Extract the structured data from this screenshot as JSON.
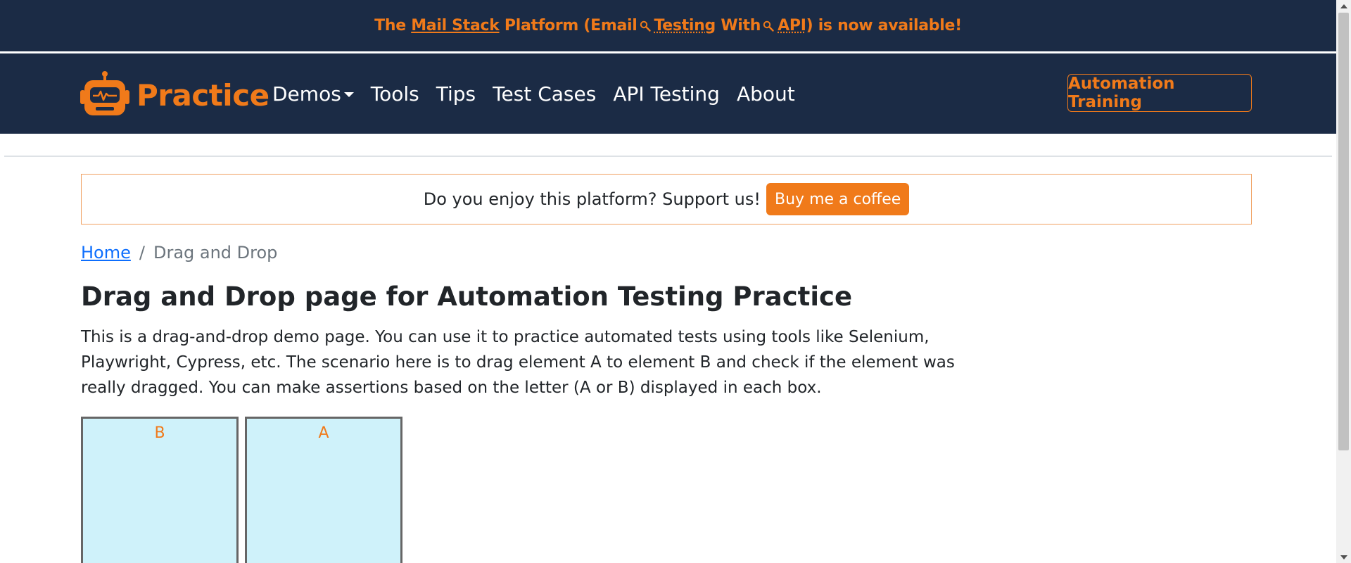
{
  "colors": {
    "navy": "#1b2b45",
    "accent_orange": "#f07a1a",
    "box_fill": "#cff2fa",
    "link_blue": "#0d6efd"
  },
  "announcement": {
    "part1": "The ",
    "mail_stack": "Mail Stack",
    "part2": " Platform (Email",
    "testing": "Testing",
    "part3": " With",
    "api": "API",
    "part4": ") is now available!"
  },
  "navbar": {
    "brand": "Practice",
    "links": [
      "Demos",
      "Tools",
      "Tips",
      "Test Cases",
      "API Testing",
      "About"
    ],
    "training_button": "Automation Training"
  },
  "support": {
    "text": "Do you enjoy this platform? Support us!",
    "button": "Buy me a coffee"
  },
  "breadcrumb": {
    "home": "Home",
    "separator": "/",
    "current": "Drag and Drop"
  },
  "main": {
    "title": "Drag and Drop page for Automation Testing Practice",
    "description": "This is a drag-and-drop demo page. You can use it to practice automated tests using tools like Selenium, Playwright, Cypress, etc. The scenario here is to drag element A to element B and check if the element was really dragged. You can make assertions based on the letter (A or B) displayed in each box."
  },
  "boxes": [
    {
      "letter": "B"
    },
    {
      "letter": "A"
    }
  ],
  "icons": {
    "brand_logo": "robot-icon",
    "announcement_search": "magnifier-icon",
    "demos_dropdown": "caret-down-icon"
  }
}
